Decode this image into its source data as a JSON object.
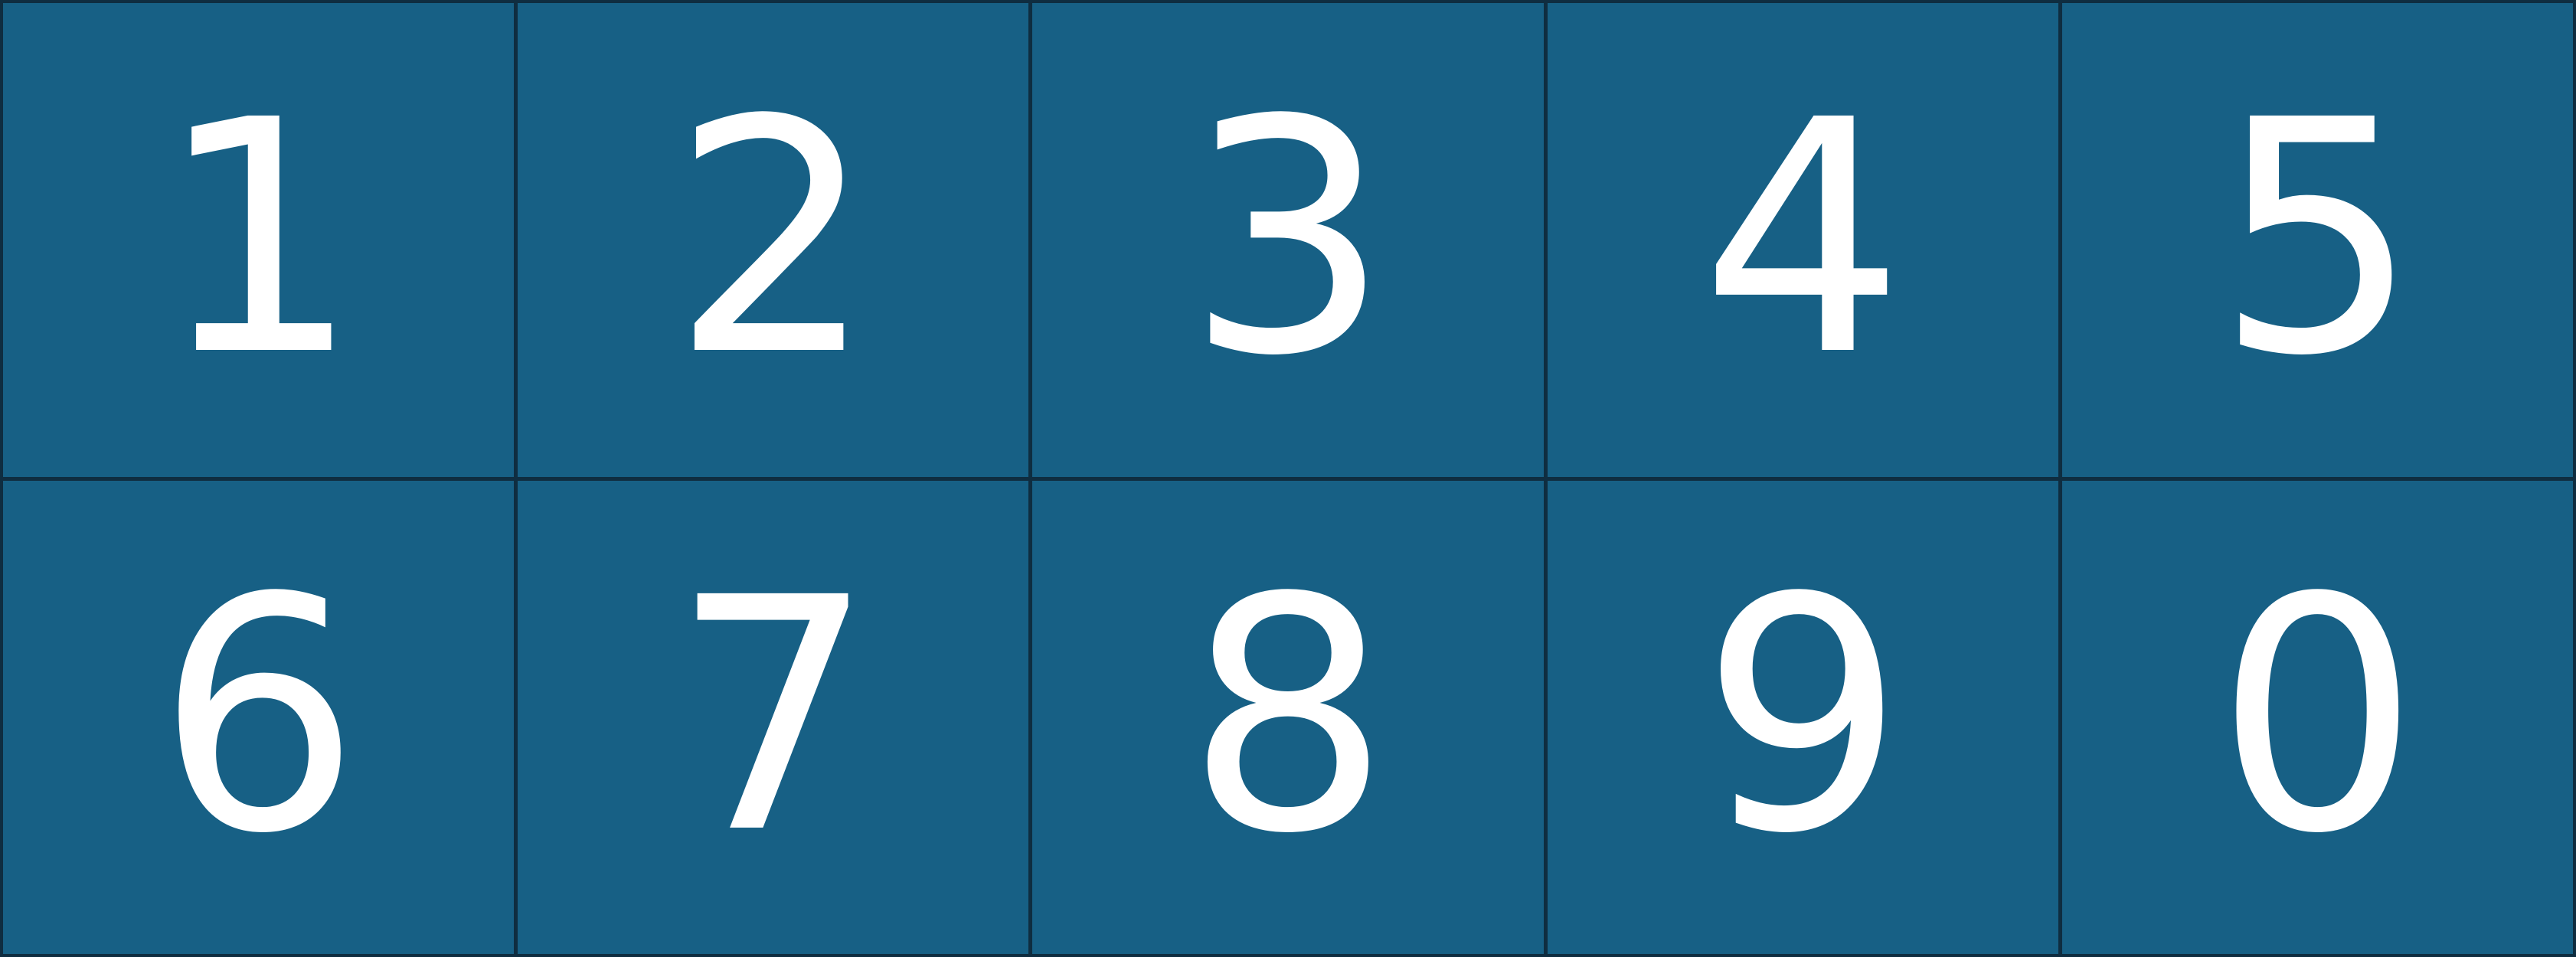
{
  "keypad": {
    "keys": [
      {
        "label": "1"
      },
      {
        "label": "2"
      },
      {
        "label": "3"
      },
      {
        "label": "4"
      },
      {
        "label": "5"
      },
      {
        "label": "6"
      },
      {
        "label": "7"
      },
      {
        "label": "8"
      },
      {
        "label": "9"
      },
      {
        "label": "0"
      }
    ]
  },
  "colors": {
    "key_background": "#176085",
    "grid_lines": "#0f2d40",
    "label_text": "#ffffff"
  }
}
